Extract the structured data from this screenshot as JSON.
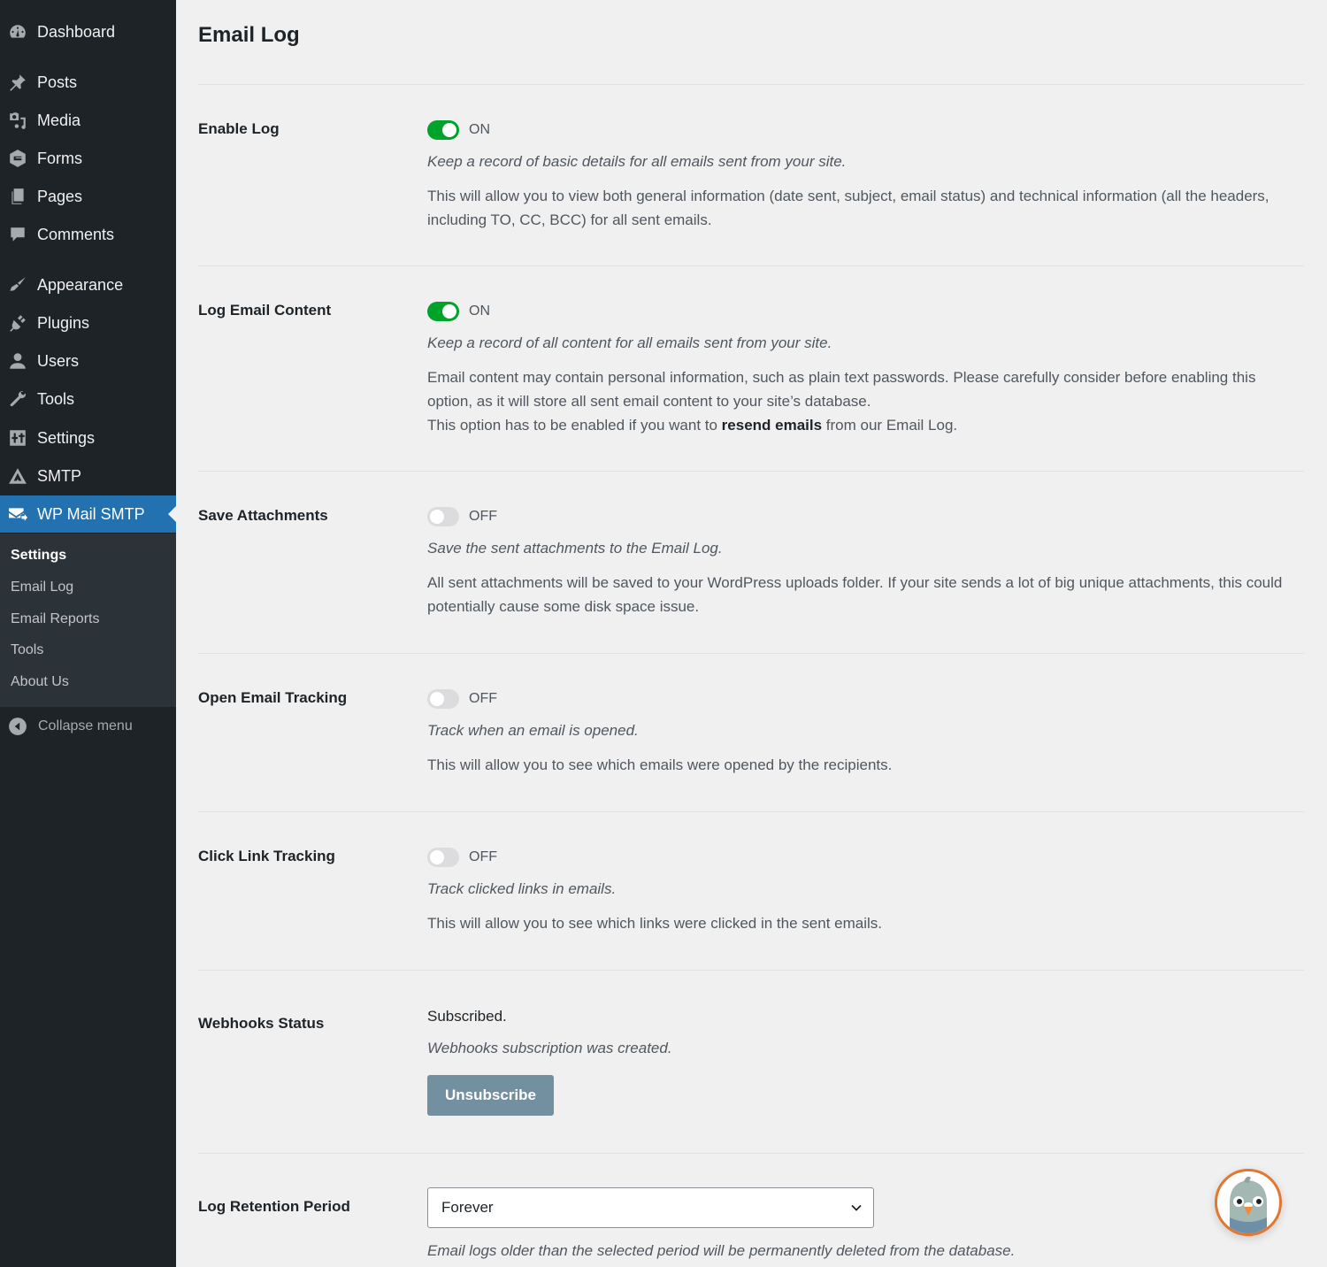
{
  "sidebar": {
    "items": [
      {
        "label": "Dashboard",
        "icon": "dashboard-icon"
      },
      {
        "label": "Posts",
        "icon": "pin-icon"
      },
      {
        "label": "Media",
        "icon": "media-icon"
      },
      {
        "label": "Forms",
        "icon": "forms-icon"
      },
      {
        "label": "Pages",
        "icon": "pages-icon"
      },
      {
        "label": "Comments",
        "icon": "comment-icon"
      },
      {
        "label": "Appearance",
        "icon": "paintbrush-icon"
      },
      {
        "label": "Plugins",
        "icon": "plug-icon"
      },
      {
        "label": "Users",
        "icon": "user-icon"
      },
      {
        "label": "Tools",
        "icon": "wrench-icon"
      },
      {
        "label": "Settings",
        "icon": "sliders-icon"
      },
      {
        "label": "SMTP",
        "icon": "smtp-triangle-icon"
      },
      {
        "label": "WP Mail SMTP",
        "icon": "mail-send-icon",
        "active": true
      }
    ],
    "submenu": [
      {
        "label": "Settings",
        "current": true
      },
      {
        "label": "Email Log"
      },
      {
        "label": "Email Reports"
      },
      {
        "label": "Tools"
      },
      {
        "label": "About Us"
      }
    ],
    "collapse_label": "Collapse menu"
  },
  "page": {
    "title": "Email Log",
    "settings": {
      "enable_log": {
        "label": "Enable Log",
        "state": "ON",
        "enabled": true,
        "summary": "Keep a record of basic details for all emails sent from your site.",
        "description": "This will allow you to view both general information (date sent, subject, email status) and technical information (all the headers, including TO, CC, BCC) for all sent emails."
      },
      "log_content": {
        "label": "Log Email Content",
        "state": "ON",
        "enabled": true,
        "summary": "Keep a record of all content for all emails sent from your site.",
        "description": "Email content may contain personal information, such as plain text passwords. Please carefully consider before enabling this option, as it will store all sent email content to your site’s database.",
        "description2_pre": "This option has to be enabled if you want to ",
        "description2_bold": "resend emails",
        "description2_post": " from our Email Log."
      },
      "save_attachments": {
        "label": "Save Attachments",
        "state": "OFF",
        "enabled": false,
        "summary": "Save the sent attachments to the Email Log.",
        "description": "All sent attachments will be saved to your WordPress uploads folder. If your site sends a lot of big unique attachments, this could potentially cause some disk space issue."
      },
      "open_tracking": {
        "label": "Open Email Tracking",
        "state": "OFF",
        "enabled": false,
        "summary": "Track when an email is opened.",
        "description": "This will allow you to see which emails were opened by the recipients."
      },
      "click_tracking": {
        "label": "Click Link Tracking",
        "state": "OFF",
        "enabled": false,
        "summary": "Track clicked links in emails.",
        "description": "This will allow you to see which links were clicked in the sent emails."
      },
      "webhooks": {
        "label": "Webhooks Status",
        "status": "Subscribed.",
        "summary": "Webhooks subscription was created.",
        "button_label": "Unsubscribe"
      },
      "retention": {
        "label": "Log Retention Period",
        "selected": "Forever",
        "description": "Email logs older than the selected period will be permanently deleted from the database."
      }
    }
  },
  "colors": {
    "sidebar_bg": "#1d2327",
    "active_menu": "#2271b1",
    "toggle_on": "#00a32a",
    "button": "#72909f",
    "mascot_ring": "#e27730"
  }
}
